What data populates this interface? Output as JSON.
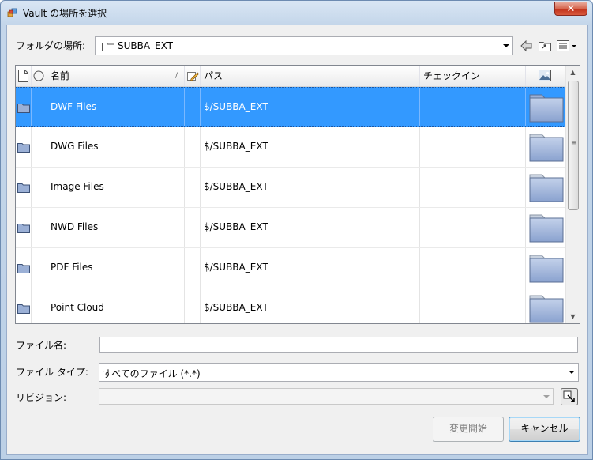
{
  "window": {
    "title": "Vault の場所を選択",
    "close_glyph": "✕"
  },
  "location": {
    "label": "フォルダの場所:",
    "value": "SUBBA_EXT"
  },
  "grid": {
    "columns": {
      "name": "名前",
      "path": "パス",
      "checkin": "チェックイン"
    },
    "rows": [
      {
        "name": "DWF Files",
        "path": "$/SUBBA_EXT",
        "checkin": "",
        "selected": true
      },
      {
        "name": "DWG Files",
        "path": "$/SUBBA_EXT",
        "checkin": "",
        "selected": false
      },
      {
        "name": "Image Files",
        "path": "$/SUBBA_EXT",
        "checkin": "",
        "selected": false
      },
      {
        "name": "NWD Files",
        "path": "$/SUBBA_EXT",
        "checkin": "",
        "selected": false
      },
      {
        "name": "PDF Files",
        "path": "$/SUBBA_EXT",
        "checkin": "",
        "selected": false
      },
      {
        "name": "Point Cloud",
        "path": "$/SUBBA_EXT",
        "checkin": "",
        "selected": false
      }
    ]
  },
  "form": {
    "filename_label": "ファイル名:",
    "filename_value": "",
    "filetype_label": "ファイル タイプ:",
    "filetype_value": "すべてのファイル (*.*)",
    "revision_label": "リビジョン:",
    "revision_value": ""
  },
  "buttons": {
    "open": "変更開始",
    "cancel": "キャンセル"
  },
  "colors": {
    "selection": "#3399ff",
    "folder_fill": "#9bb0d6"
  },
  "icons": [
    "vault-app-icon",
    "close-icon",
    "folder-icon",
    "back-arrow-icon",
    "up-folder-icon",
    "view-menu-icon",
    "document-icon",
    "circle-status-icon",
    "edit-pencil-icon",
    "thumbnail-icon",
    "revision-picker-icon"
  ]
}
